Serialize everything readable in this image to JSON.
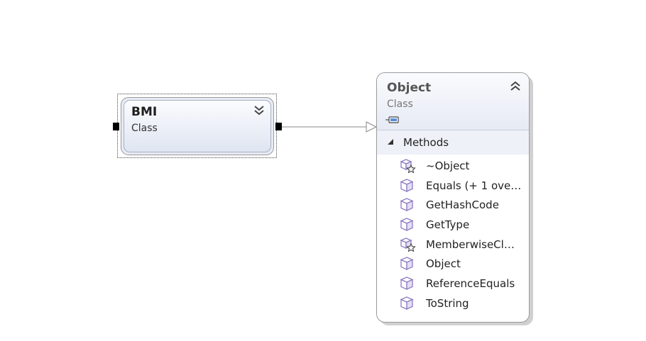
{
  "classes": {
    "bmi": {
      "name": "BMI",
      "stereotype": "Class",
      "toggle_icon": "chevron-double-down-icon"
    },
    "object": {
      "name": "Object",
      "stereotype": "Class",
      "toggle_icon": "chevron-double-up-icon",
      "kind_icon": "class-shortcut-icon",
      "section": {
        "label": "Methods",
        "icon": "expanded-triangle-icon"
      },
      "members": [
        {
          "label": "~Object",
          "icon": "protected-method-icon"
        },
        {
          "label": "Equals (+ 1 ove…",
          "icon": "public-method-icon"
        },
        {
          "label": "GetHashCode",
          "icon": "public-method-icon"
        },
        {
          "label": "GetType",
          "icon": "public-method-icon"
        },
        {
          "label": "MemberwiseCl…",
          "icon": "protected-method-icon"
        },
        {
          "label": "Object",
          "icon": "public-method-icon"
        },
        {
          "label": "ReferenceEquals",
          "icon": "public-method-icon"
        },
        {
          "label": "ToString",
          "icon": "public-method-icon"
        }
      ]
    }
  },
  "relationship": {
    "type": "inheritance",
    "from": "BMI",
    "to": "Object"
  },
  "colors": {
    "method_icon": "#8e7cc3",
    "header_fill": "#e6eaf4",
    "border": "#9a9a9a",
    "connector": "#888888"
  }
}
